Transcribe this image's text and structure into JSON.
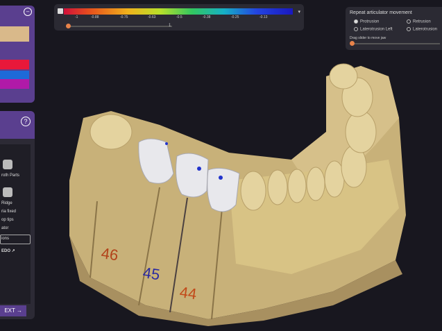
{
  "colorbar": {
    "ticks": [
      "-1",
      "-0.88",
      "-0.75",
      "-0.63",
      "-0.5",
      "-0.38",
      "-0.25",
      "-0.13"
    ],
    "slider_marker": "1"
  },
  "articulator": {
    "title": "Repeat articulator movement",
    "options": [
      "Protrusion",
      "Retrusion",
      "Laterotrusion Left",
      "Laterotrusion"
    ],
    "selected": "Protrusion",
    "drag_hint": "Drag slider to move jaw"
  },
  "left_panel": {
    "items": [
      "roth Parts",
      "Ridge",
      "ria fixed",
      "op tips",
      "ator",
      "ions"
    ],
    "redo_label": "EDO ↗",
    "next_label": "EXT",
    "swatch_colors": [
      "#d9b98a",
      "#5a3f8f",
      "#1e3fd8",
      "#e8183a",
      "#1e6ad8",
      "#b01aa8"
    ]
  },
  "model": {
    "labels": [
      "46",
      "45",
      "44"
    ],
    "label_colors": [
      "#b2421a",
      "#2a2aa0",
      "#c24a1a"
    ]
  }
}
